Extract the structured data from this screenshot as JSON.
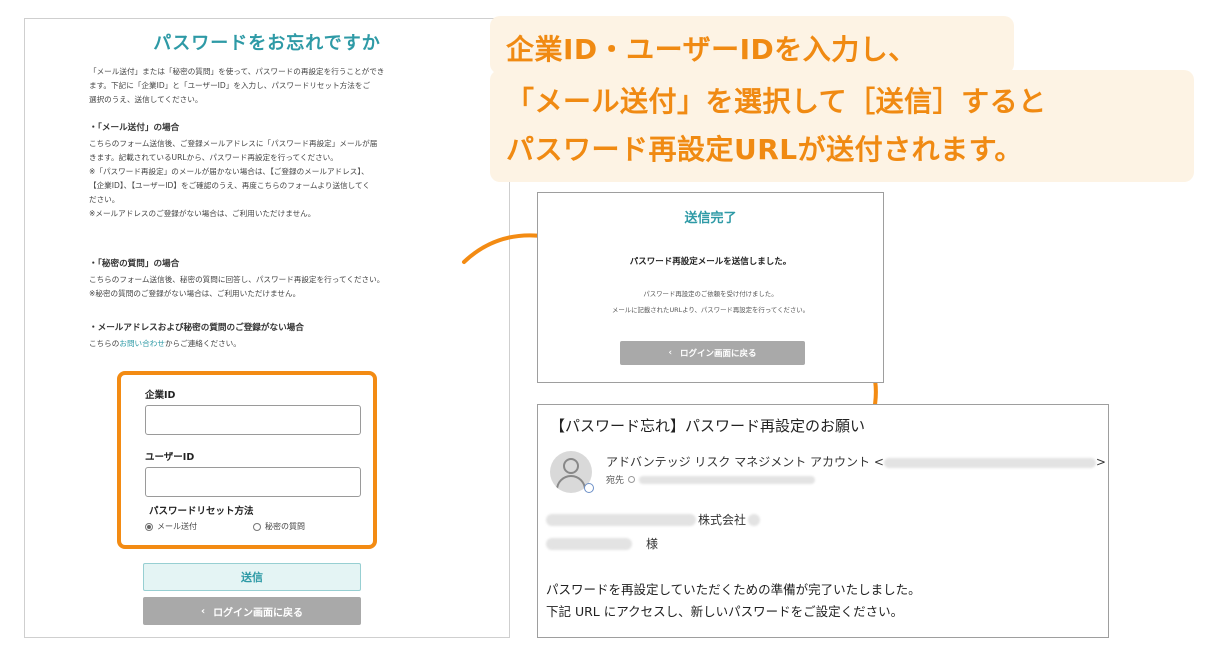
{
  "left_panel": {
    "title": "パスワードをお忘れですか",
    "intro": [
      "「メール送付」または「秘密の質問」を使って、パスワードの再設定を行うことができ",
      "ます。下記に「企業ID」と「ユーザーID」を入力し、パスワードリセット方法をご",
      "選択のうえ、送信してください。"
    ],
    "section1_head": "・「メール送付」の場合",
    "section1_text": [
      "こちらのフォーム送信後、ご登録メールアドレスに「パスワード再設定」メールが届",
      "きます。記載されているURLから、パスワード再設定を行ってください。",
      "※「パスワード再設定」のメールが届かない場合は、【ご登録のメールアドレス】、",
      "【企業ID】、【ユーザーID】をご確認のうえ、再度こちらのフォームより送信してく",
      "ださい。",
      "※メールアドレスのご登録がない場合は、ご利用いただけません。"
    ],
    "section2_head": "・「秘密の質問」の場合",
    "section2_text": [
      "こちらのフォーム送信後、秘密の質問に回答し、パスワード再設定を行ってください。",
      "※秘密の質問のご登録がない場合は、ご利用いただけません。"
    ],
    "section3_head": "・メールアドレスおよび秘密の質問のご登録がない場合",
    "section3_pre": "こちらの",
    "section3_link": "お問い合わせ",
    "section3_post": "からご連絡ください。",
    "form": {
      "company_id_label": "企業ID",
      "user_id_label": "ユーザーID",
      "reset_method_label": "パスワードリセット方法",
      "option_mail": "メール送付",
      "option_secret": "秘密の質問"
    },
    "send_label": "送信",
    "back_label": "ログイン画面に戻る"
  },
  "callout": {
    "line1": "企業ID・ユーザーIDを入力し、",
    "line2": "「メール送付」を選択して［送信］すると",
    "line3": "パスワード再設定URLが送付されます。"
  },
  "done_panel": {
    "title": "送信完了",
    "message": "パスワード再設定メールを送信しました。",
    "sub1": "パスワード再設定のご依頼を受け付けました。",
    "sub2": "メールに記載されたURLより、パスワード再設定を行ってください。",
    "back_label": "ログイン画面に戻る"
  },
  "mail": {
    "subject": "【パスワード忘れ】パスワード再設定のお願い",
    "sender_name": "アドバンテッジ リスク マネジメント アカウント <",
    "sender_close": ">",
    "to_label": "宛先",
    "company_suffix": "株式会社",
    "honorific": "様",
    "body1": "パスワードを再設定していただくための準備が完了いたしました。",
    "body2": "下記 URL にアクセスし、新しいパスワードをご設定ください。"
  },
  "colors": {
    "accent": "#2e9aa6",
    "highlight": "#f38b13",
    "callout_bg": "#fdf3e4"
  }
}
